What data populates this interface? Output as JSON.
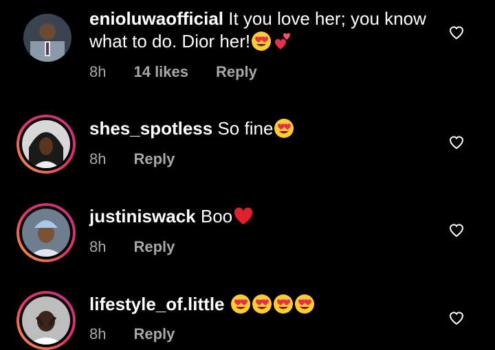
{
  "comments": [
    {
      "username": "enioluwaofficial",
      "text": "It you love her; you know what to do. Dior her!",
      "time": "8h",
      "likes": "14 likes",
      "reply": "Reply",
      "emojis": [
        "heart-eyes",
        "two-hearts"
      ]
    },
    {
      "username": "shes_spotless",
      "text": "So fine",
      "time": "8h",
      "reply": "Reply",
      "emojis": [
        "heart-eyes"
      ]
    },
    {
      "username": "justiniswack",
      "text": "Boo",
      "time": "8h",
      "reply": "Reply",
      "emojis": [
        "red-heart"
      ]
    },
    {
      "username": "lifestyle_of.little",
      "text": "",
      "time": "8h",
      "reply": "Reply",
      "emojis": [
        "heart-eyes",
        "heart-eyes",
        "heart-eyes",
        "heart-eyes"
      ]
    }
  ],
  "colors": {
    "background": "#000000",
    "meta_text": "#a8a8a8",
    "story_ring_start": "#f9a33a",
    "story_ring_end": "#c13584"
  }
}
